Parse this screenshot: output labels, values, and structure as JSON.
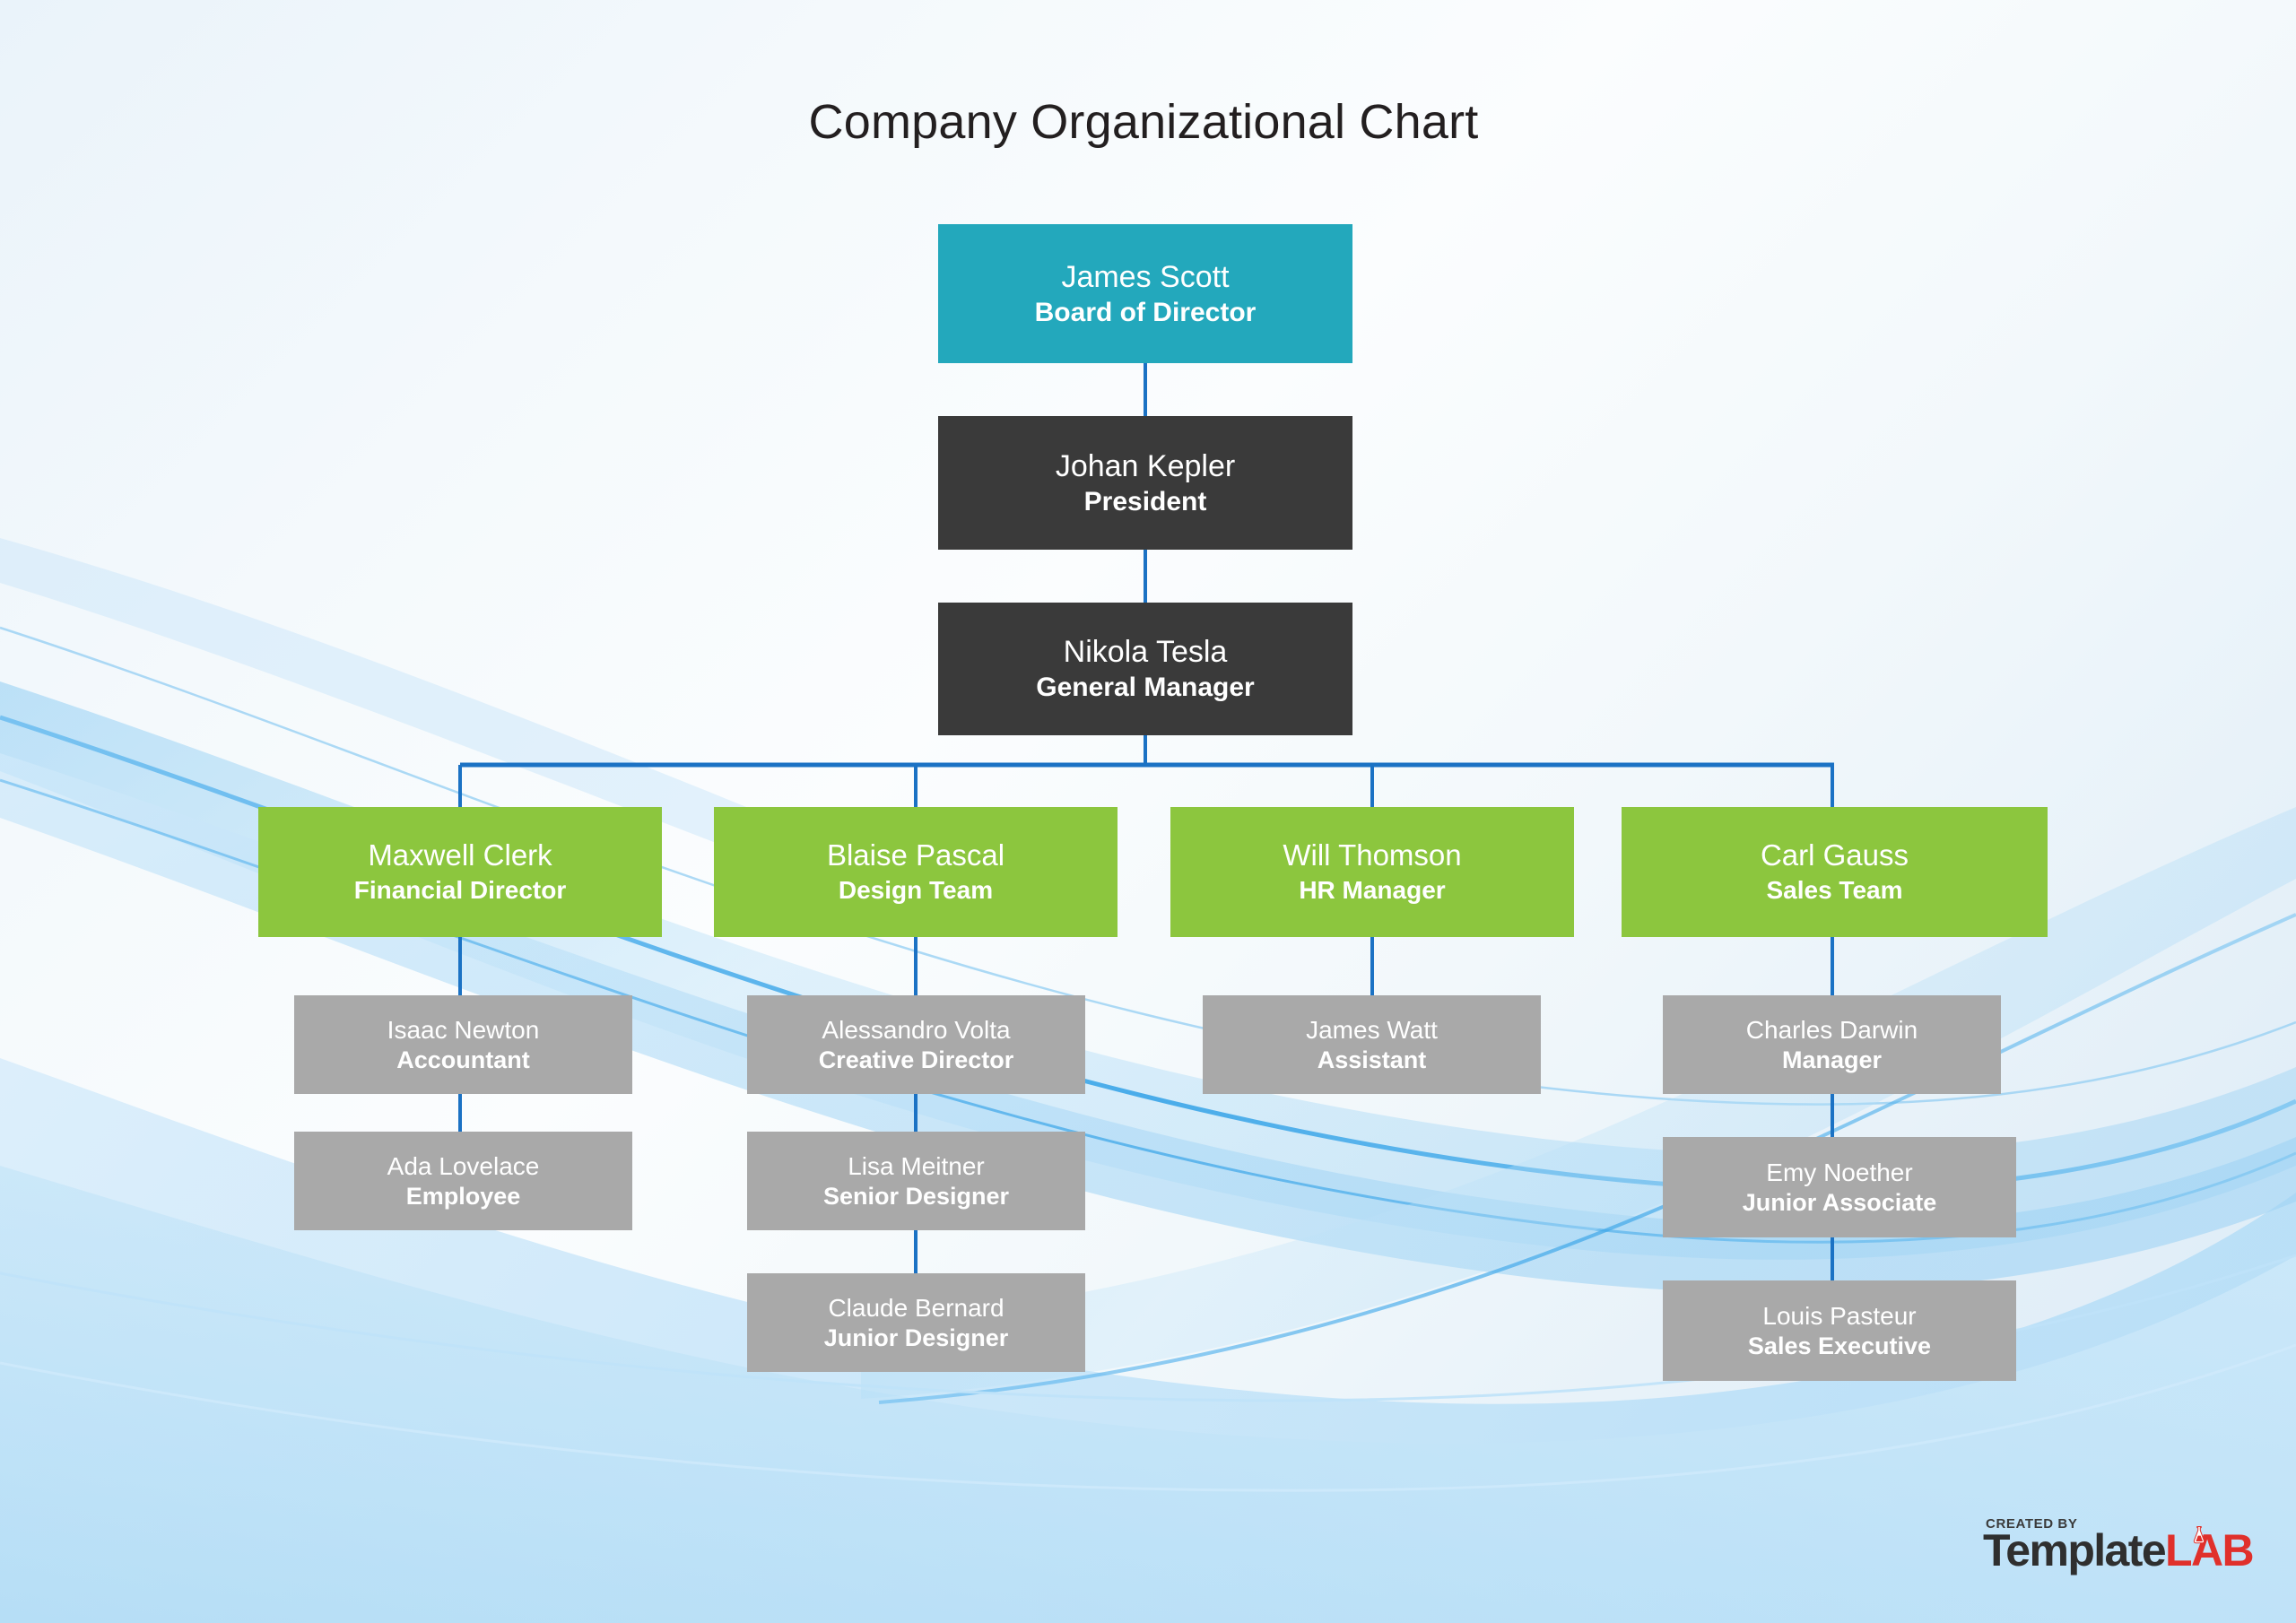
{
  "title": "Company Organizational Chart",
  "colors": {
    "board": "#23A8BC",
    "executive": "#3A3A3A",
    "department": "#8CC63E",
    "staff": "#A9A9A9",
    "connector": "#1B72C4",
    "title_text": "#231F20",
    "node_text": "#FFFFFF",
    "logo_dark": "#2F2F2F",
    "logo_red": "#E0302B"
  },
  "chart_data": {
    "type": "diagram",
    "subtype": "org-chart",
    "title": "Company Organizational Chart",
    "levels": 5,
    "nodes": [
      {
        "id": "n1",
        "name": "James Scott",
        "role": "Board of Director",
        "tier": "board",
        "level": 1,
        "parent": null
      },
      {
        "id": "n2",
        "name": "Johan Kepler",
        "role": "President",
        "tier": "executive",
        "level": 2,
        "parent": "n1"
      },
      {
        "id": "n3",
        "name": "Nikola Tesla",
        "role": "General Manager",
        "tier": "executive",
        "level": 3,
        "parent": "n2"
      },
      {
        "id": "n4",
        "name": "Maxwell Clerk",
        "role": "Financial Director",
        "tier": "department",
        "level": 4,
        "parent": "n3"
      },
      {
        "id": "n5",
        "name": "Blaise Pascal",
        "role": "Design Team",
        "tier": "department",
        "level": 4,
        "parent": "n3"
      },
      {
        "id": "n6",
        "name": "Will Thomson",
        "role": "HR Manager",
        "tier": "department",
        "level": 4,
        "parent": "n3"
      },
      {
        "id": "n7",
        "name": "Carl Gauss",
        "role": "Sales Team",
        "tier": "department",
        "level": 4,
        "parent": "n3"
      },
      {
        "id": "n8",
        "name": "Isaac Newton",
        "role": "Accountant",
        "tier": "staff",
        "level": 5,
        "parent": "n4"
      },
      {
        "id": "n9",
        "name": "Ada Lovelace",
        "role": "Employee",
        "tier": "staff",
        "level": 6,
        "parent": "n8"
      },
      {
        "id": "n10",
        "name": "Alessandro Volta",
        "role": "Creative Director",
        "tier": "staff",
        "level": 5,
        "parent": "n5"
      },
      {
        "id": "n11",
        "name": "Lisa Meitner",
        "role": "Senior Designer",
        "tier": "staff",
        "level": 6,
        "parent": "n10"
      },
      {
        "id": "n12",
        "name": "Claude Bernard",
        "role": "Junior Designer",
        "tier": "staff",
        "level": 7,
        "parent": "n11"
      },
      {
        "id": "n13",
        "name": "James Watt",
        "role": "Assistant",
        "tier": "staff",
        "level": 5,
        "parent": "n6"
      },
      {
        "id": "n14",
        "name": "Charles Darwin",
        "role": "Manager",
        "tier": "staff",
        "level": 5,
        "parent": "n7"
      },
      {
        "id": "n15",
        "name": "Emy Noether",
        "role": "Junior Associate",
        "tier": "staff",
        "level": 6,
        "parent": "n14"
      },
      {
        "id": "n16",
        "name": "Louis Pasteur",
        "role": "Sales Executive",
        "tier": "staff",
        "level": 7,
        "parent": "n15"
      }
    ]
  },
  "nodes": {
    "board_of_director": {
      "name": "James Scott",
      "role": "Board of Director"
    },
    "president": {
      "name": "Johan Kepler",
      "role": "President"
    },
    "general_manager": {
      "name": "Nikola Tesla",
      "role": "General Manager"
    },
    "financial_director": {
      "name": "Maxwell Clerk",
      "role": "Financial Director"
    },
    "design_team": {
      "name": "Blaise Pascal",
      "role": "Design Team"
    },
    "hr_manager": {
      "name": "Will Thomson",
      "role": "HR Manager"
    },
    "sales_team": {
      "name": "Carl Gauss",
      "role": "Sales Team"
    },
    "accountant": {
      "name": "Isaac Newton",
      "role": "Accountant"
    },
    "employee": {
      "name": "Ada Lovelace",
      "role": "Employee"
    },
    "creative_director": {
      "name": "Alessandro Volta",
      "role": "Creative Director"
    },
    "senior_designer": {
      "name": "Lisa Meitner",
      "role": "Senior Designer"
    },
    "junior_designer": {
      "name": "Claude Bernard",
      "role": "Junior Designer"
    },
    "assistant": {
      "name": "James Watt",
      "role": "Assistant"
    },
    "manager": {
      "name": "Charles Darwin",
      "role": "Manager"
    },
    "junior_associate": {
      "name": "Emy Noether",
      "role": "Junior Associate"
    },
    "sales_executive": {
      "name": "Louis Pasteur",
      "role": "Sales Executive"
    }
  },
  "footer": {
    "created_by": "CREATED BY",
    "brand_first": "Template",
    "brand_second": "LAB"
  }
}
